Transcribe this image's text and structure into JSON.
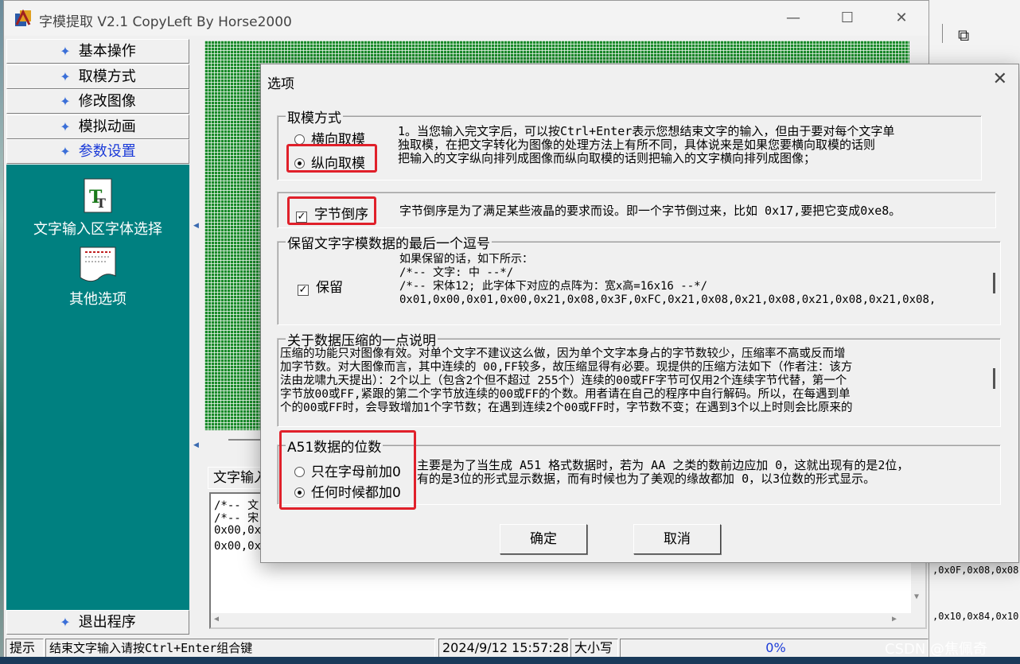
{
  "window": {
    "title": "字模提取 V2.1  CopyLeft By Horse2000",
    "minimize": "—",
    "maximize": "☐",
    "close": "✕"
  },
  "nav": {
    "items": [
      "基本操作",
      "取模方式",
      "修改图像",
      "模拟动画",
      "参数设置"
    ],
    "panel_items": [
      "文字输入区字体选择",
      "其他选项"
    ],
    "exit": "退出程序"
  },
  "text_tab": "文字输入",
  "code_lines": [
    "/*--  文",
    "/*--  宋",
    "0x00,0x",
    "0x00,0x"
  ],
  "status": {
    "hint_label": "提示",
    "hint": "结束文字输入请按Ctrl+Enter组合键",
    "datetime": "2024/9/12 15:57:28",
    "caps": "大小写",
    "progress": "0%"
  },
  "watermark": "CSDN @焦佩奇",
  "behind": {
    "frag1": ",0x0F,0x08,0x08,",
    "frag2": ",0x10,0x84,0x10,"
  },
  "dialog": {
    "title": "选项",
    "close": "✕",
    "group1": {
      "title": "取模方式",
      "opt1": "横向取模",
      "opt2": "纵向取模",
      "selected": "纵向取模",
      "desc": [
        "1。当您输入完文字后，可以按Ctrl+Enter表示您想结束文字的输入，但由于要对每个文字单",
        "独取模，在把文字转化为图像的处理方法上有所不同，具体说来是如果您要横向取模的话则",
        "把输入的文字纵向排列成图像而纵向取模的话则把输入的文字横向排列成图像；"
      ]
    },
    "group2": {
      "check": "字节倒序",
      "checked": true,
      "desc": "字节倒序是为了满足某些液晶的要求而设。即一个字节倒过来，比如 0x17,要把它变成0xe8。"
    },
    "group3": {
      "title": "保留文字字模数据的最后一个逗号",
      "check": "保留",
      "checked": true,
      "desc": [
        "如果保留的话，如下所示：",
        "/*--  文字:  中  --*/",
        "/*--  宋体12;  此字体下对应的点阵为：宽x高=16x16   --*/",
        "0x01,0x00,0x01,0x00,0x21,0x08,0x3F,0xFC,0x21,0x08,0x21,0x08,0x21,0x08,0x21,0x08,"
      ]
    },
    "group4": {
      "title": "关于数据压缩的一点说明",
      "desc": [
        "压缩的功能只对图像有效。对单个文字不建议这么做，因为单个文字本身占的字节数较少，压缩率不高或反而增",
        "加字节数。对大图像而言，其中连续的 00,FF较多，故压缩显得有必要。现提供的压缩方法如下（作者注：该方",
        "法由龙啸九天提出）：2个以上（包含2个但不超过 255个）连续的00或FF字节可仅用2个连续字节代替，第一个",
        "字节放00或FF,紧跟的第二个字节放连续的00或FF的个数。用者请在自己的程序中自行解码。所以，在每遇到单",
        "个的00或FF时，会导致增加1个字节数；在遇到连续2个00或FF时，字节数不变；在遇到3个以上时则会比原来的"
      ]
    },
    "group5": {
      "title": "A51数据的位数",
      "opt1": "只在字母前加0",
      "opt2": "任何时候都加0",
      "selected": "任何时候都加0",
      "desc": [
        "主要是为了当生成 A51 格式数据时，若为 AA 之类的数前边应加 0，这就出现有的是2位，",
        "有的是3位的形式显示数据，而有时候也为了美观的缘故都加 0，以3位数的形式显示。"
      ]
    },
    "ok": "确定",
    "cancel": "取消"
  }
}
